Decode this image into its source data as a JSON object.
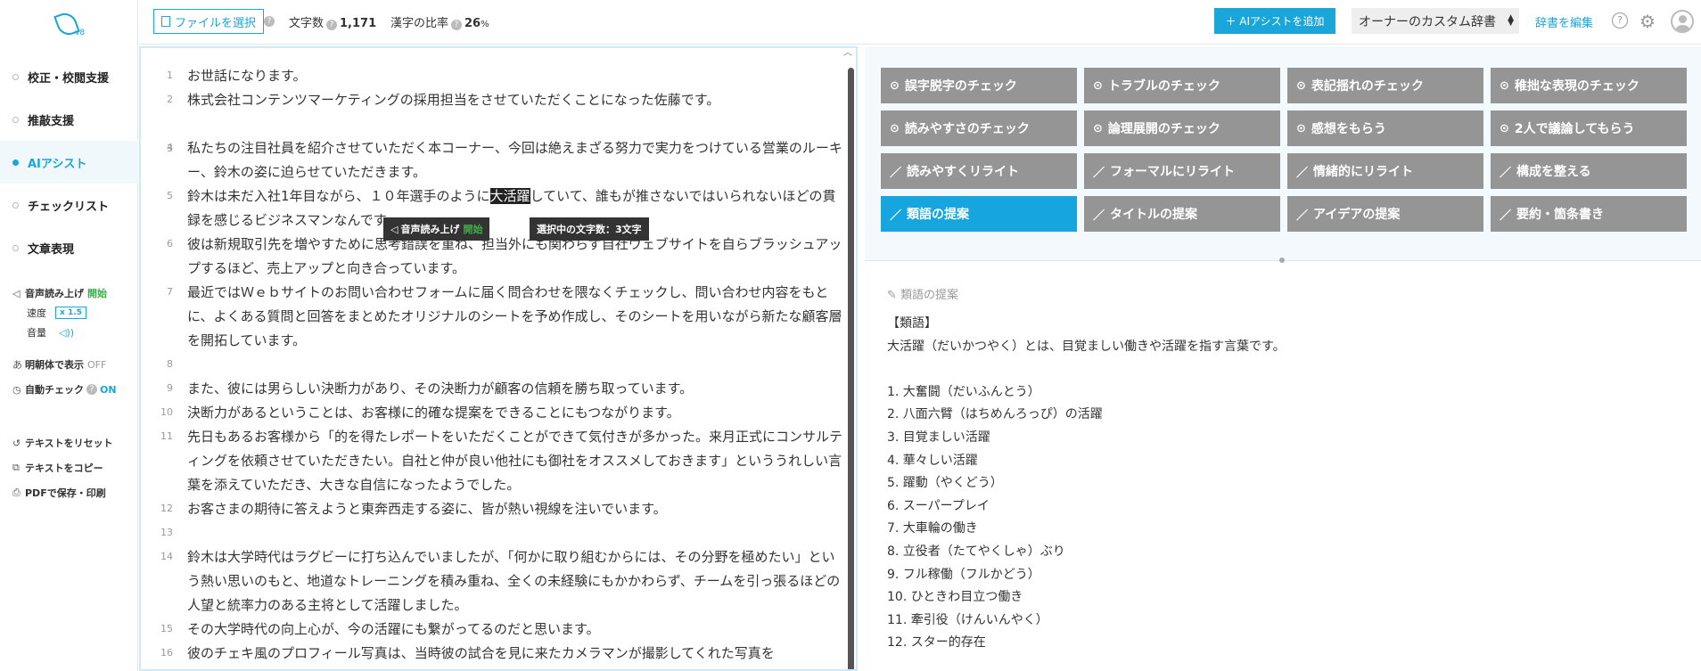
{
  "sidebar": {
    "version": "v8",
    "nav": [
      {
        "label": "校正・校閲支援",
        "active": false
      },
      {
        "label": "推敲支援",
        "active": false
      },
      {
        "label": "AIアシスト",
        "active": true
      },
      {
        "label": "チェックリスト",
        "active": false
      },
      {
        "label": "文章表現",
        "active": false
      }
    ],
    "tts_label": "音声読み上げ",
    "tts_start": "開始",
    "speed_label": "速度",
    "speed_value": "x 1.5",
    "volume_label": "音量",
    "mincho_label": "明朝体で表示",
    "mincho_value": "OFF",
    "autocheck_label": "自動チェック",
    "autocheck_value": "ON",
    "reset_label": "テキストをリセット",
    "copy_label": "テキストをコピー",
    "pdf_label": "PDFで保存・印刷"
  },
  "topbar": {
    "file_button": "ファイルを選択",
    "char_count_label": "文字数",
    "char_count_value": "1,171",
    "kanji_label": "漢字の比率",
    "kanji_value": "26",
    "kanji_unit": "%",
    "add_ai_button": "＋ AIアシストを追加",
    "dictionary": "オーナーのカスタム辞書",
    "edit_dictionary": "辞書を編集"
  },
  "editor": {
    "lines": [
      {
        "num": "1",
        "text": "お世話になります。"
      },
      {
        "num": "2",
        "text": "株式会社コンテンツマーケティングの採用担当をさせていただくことになった佐藤です。"
      },
      {
        "num": "3",
        "text": ""
      },
      {
        "num": "4",
        "text": "私たちの注目社員を紹介させていただく本コーナー、今回は絶えまざる努力で実力をつけている営業のルーキー、鈴木の姿に迫らせていただきます。"
      },
      {
        "num": "5",
        "text_before": "鈴木は未だ入社1年目ながら、１０年選手のように",
        "text_selected": "大活躍",
        "text_after": "していて、誰もが推さないではいられないほどの貫録を感じるビジネスマンなんです。"
      },
      {
        "num": "6",
        "text": "彼は新規取引先を増やすために思考錯誤を重ね、担当外にも関わらず自社ウェブサイトを自らブラッシュアップするほど、売上アップと向き合っています。"
      },
      {
        "num": "7",
        "text": "最近ではＷｅｂサイトのお問い合わせフォームに届く問合わせを隈なくチェックし、問い合わせ内容をもとに、よくある質問と回答をまとめたオリジナルのシートを予め作成し、そのシートを用いながら新たな顧客層を開拓しています。"
      },
      {
        "num": "8",
        "text": ""
      },
      {
        "num": "9",
        "text": "また、彼には男らしい決断力があり、その決断力が顧客の信頼を勝ち取っています。"
      },
      {
        "num": "10",
        "text": "決断力があるということは、お客様に的確な提案をできることにもつながります。"
      },
      {
        "num": "11",
        "text": "先日もあるお客様から「的を得たレポートをいただくことができて気付きが多かった。来月正式にコンサルティングを依頼させていただきたい。自社と仲が良い他社にも御社をオススメしておきます」といううれしい言葉を添えていただき、大きな自信になったようでした。"
      },
      {
        "num": "12",
        "text": "お客さまの期待に答えようと東奔西走する姿に、皆が熱い視線を注いでいます。"
      },
      {
        "num": "13",
        "text": ""
      },
      {
        "num": "14",
        "text": "鈴木は大学時代はラグビーに打ち込んでいましたが、「何かに取り組むからには、その分野を極めたい」という熱い思いのもと、地道なトレーニングを積み重ね、全くの未経験にもかかわらず、チームを引っ張るほどの人望と統率力のある主将として活躍しました。"
      },
      {
        "num": "15",
        "text": "その大学時代の向上心が、今の活躍にも繋がってるのだと思います。"
      },
      {
        "num": "16",
        "text": "彼のチェキ風のプロフィール写真は、当時彼の試合を見に来たカメラマンが撮影してくれた写真を"
      }
    ],
    "tip_tts": "音声読み上げ",
    "tip_tts_start": "開始",
    "tip_selection": "選択中の文字数：3文字"
  },
  "ai_buttons": [
    {
      "label": "誤字脱字のチェック",
      "kind": "check",
      "active": false
    },
    {
      "label": "トラブルのチェック",
      "kind": "check",
      "active": false
    },
    {
      "label": "表記揺れのチェック",
      "kind": "check",
      "active": false
    },
    {
      "label": "稚拙な表現のチェック",
      "kind": "check",
      "active": false
    },
    {
      "label": "読みやすさのチェック",
      "kind": "check",
      "active": false
    },
    {
      "label": "論理展開のチェック",
      "kind": "check",
      "active": false
    },
    {
      "label": "感想をもらう",
      "kind": "check",
      "active": false
    },
    {
      "label": "2人で議論してもらう",
      "kind": "check",
      "active": false
    },
    {
      "label": "読みやすくリライト",
      "kind": "pen",
      "active": false
    },
    {
      "label": "フォーマルにリライト",
      "kind": "pen",
      "active": false
    },
    {
      "label": "情緒的にリライト",
      "kind": "pen",
      "active": false
    },
    {
      "label": "構成を整える",
      "kind": "pen",
      "active": false
    },
    {
      "label": "類語の提案",
      "kind": "pen",
      "active": true
    },
    {
      "label": "タイトルの提案",
      "kind": "pen",
      "active": false
    },
    {
      "label": "アイデアの提案",
      "kind": "pen",
      "active": false
    },
    {
      "label": "要約・箇条書き",
      "kind": "pen",
      "active": false
    }
  ],
  "result": {
    "heading": "類語の提案",
    "tag": "【類語】",
    "intro": "大活躍（だいかつやく）とは、目覚ましい働きや活躍を指す言葉です。",
    "items": [
      "1. 大奮闘（だいふんとう）",
      "2. 八面六臂（はちめんろっぴ）の活躍",
      "3. 目覚ましい活躍",
      "4. 華々しい活躍",
      "5. 躍動（やくどう）",
      "6. スーパープレイ",
      "7. 大車輪の働き",
      "8. 立役者（たてやくしゃ）ぶり",
      "9. フル稼働（フルかどう）",
      "10. ひときわ目立つ働き",
      "11. 牽引役（けんいんやく）",
      "12. スター的存在"
    ]
  }
}
